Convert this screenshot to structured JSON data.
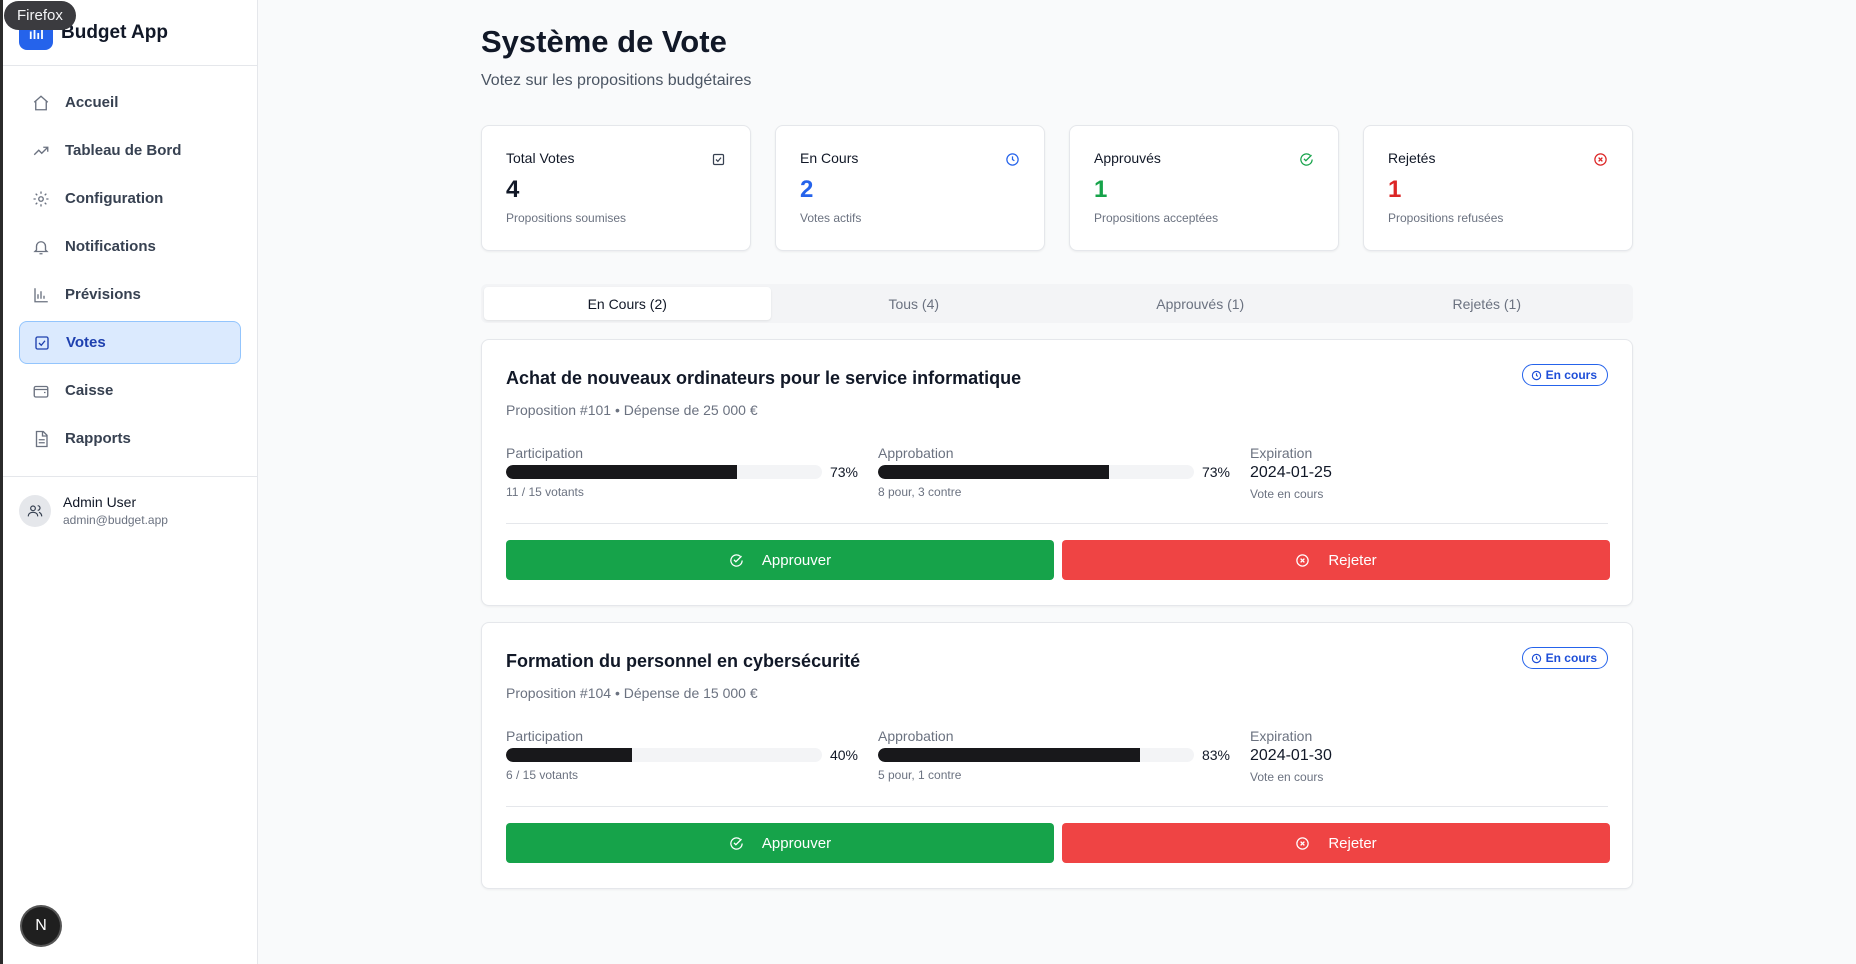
{
  "browser": {
    "label": "Firefox"
  },
  "app": {
    "name": "Budget App"
  },
  "sidebar": {
    "items": [
      {
        "label": "Accueil",
        "icon": "home-icon"
      },
      {
        "label": "Tableau de Bord",
        "icon": "trending-up-icon"
      },
      {
        "label": "Configuration",
        "icon": "gear-icon"
      },
      {
        "label": "Notifications",
        "icon": "bell-icon"
      },
      {
        "label": "Prévisions",
        "icon": "bar-chart-icon"
      },
      {
        "label": "Votes",
        "icon": "vote-icon",
        "active": true
      },
      {
        "label": "Caisse",
        "icon": "wallet-icon"
      },
      {
        "label": "Rapports",
        "icon": "file-icon"
      }
    ]
  },
  "user": {
    "name": "Admin User",
    "email": "admin@budget.app"
  },
  "badge": {
    "letter": "N"
  },
  "page": {
    "title": "Système de Vote",
    "subtitle": "Votez sur les propositions budgétaires"
  },
  "stats": [
    {
      "label": "Total Votes",
      "value": "4",
      "desc": "Propositions soumises",
      "color": "#111827",
      "icon": "vote-icon"
    },
    {
      "label": "En Cours",
      "value": "2",
      "desc": "Votes actifs",
      "color": "#2563eb",
      "icon": "clock-icon"
    },
    {
      "label": "Approuvés",
      "value": "1",
      "desc": "Propositions acceptées",
      "color": "#16a34a",
      "icon": "check-circle-icon"
    },
    {
      "label": "Rejetés",
      "value": "1",
      "desc": "Propositions refusées",
      "color": "#dc2626",
      "icon": "x-circle-icon"
    }
  ],
  "tabs": [
    {
      "label": "En Cours (2)",
      "active": true
    },
    {
      "label": "Tous (4)"
    },
    {
      "label": "Approuvés (1)"
    },
    {
      "label": "Rejetés (1)"
    }
  ],
  "proposals": [
    {
      "title": "Achat de nouveaux ordinateurs pour le service informatique",
      "status": "En cours",
      "meta": "Proposition #101 • Dépense de 25 000 €",
      "participation_label": "Participation",
      "participation_pct": "73%",
      "participation_value": 73,
      "participation_sub": "11 / 15 votants",
      "approval_label": "Approbation",
      "approval_pct": "73%",
      "approval_value": 73,
      "approval_sub": "8 pour, 3 contre",
      "expiration_label": "Expiration",
      "expiration_date": "2024-01-25",
      "expiration_sub": "Vote en cours",
      "approve_label": "Approuver",
      "reject_label": "Rejeter"
    },
    {
      "title": "Formation du personnel en cybersécurité",
      "status": "En cours",
      "meta": "Proposition #104 • Dépense de 15 000 €",
      "participation_label": "Participation",
      "participation_pct": "40%",
      "participation_value": 40,
      "participation_sub": "6 / 15 votants",
      "approval_label": "Approbation",
      "approval_pct": "83%",
      "approval_value": 83,
      "approval_sub": "5 pour, 1 contre",
      "expiration_label": "Expiration",
      "expiration_date": "2024-01-30",
      "expiration_sub": "Vote en cours",
      "approve_label": "Approuver",
      "reject_label": "Rejeter"
    }
  ]
}
